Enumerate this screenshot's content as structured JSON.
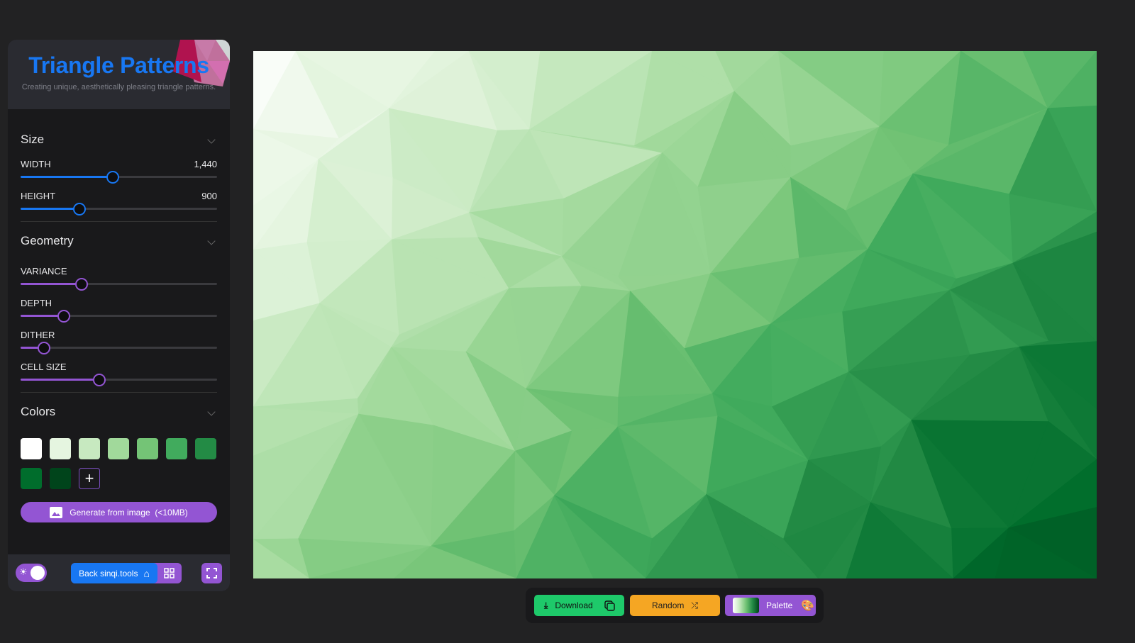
{
  "header": {
    "title": "Triangle Patterns",
    "subtitle": "Creating unique, aesthetically pleasing triangle patterns."
  },
  "size": {
    "title": "Size",
    "width_label": "WIDTH",
    "width_value": "1,440",
    "width_fraction": 0.47,
    "height_label": "HEIGHT",
    "height_value": "900",
    "height_fraction": 0.3
  },
  "geometry": {
    "title": "Geometry",
    "variance_label": "VARIANCE",
    "variance_fraction": 0.31,
    "depth_label": "DEPTH",
    "depth_fraction": 0.22,
    "dither_label": "DITHER",
    "dither_fraction": 0.12,
    "cell_size_label": "CELL SIZE",
    "cell_size_fraction": 0.4
  },
  "colors": {
    "title": "Colors",
    "swatches": [
      "#ffffff",
      "#e5f5e0",
      "#c7e9c0",
      "#a1d99b",
      "#74c476",
      "#41ab5d",
      "#238b45",
      "#006d2c",
      "#00441b"
    ],
    "add_label": "+",
    "generate_label": "Generate from image  (<10MB)"
  },
  "footer": {
    "back_label": "Back sinqi.tools"
  },
  "toolbar": {
    "download_label": "Download",
    "random_label": "Random",
    "palette_label": "Palette"
  },
  "accent": {
    "blue": "#1877f2",
    "purple": "#9355d3",
    "green": "#1ec96a",
    "orange": "#f5a623"
  }
}
